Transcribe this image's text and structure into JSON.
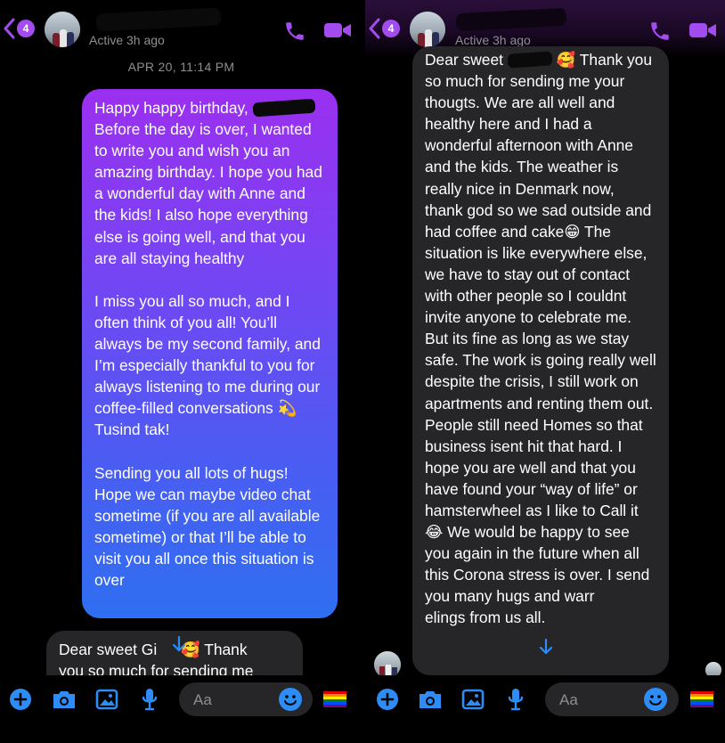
{
  "conversation": {
    "unread_count": "4",
    "status": "Active 3h ago"
  },
  "date_divider": "APR 20, 11:14 PM",
  "sent_message": {
    "para1_before_name": "Happy happy birthday, ",
    "para1_after_name": "\nBefore the day is over, I wanted to write you and wish you an amazing birthday. I hope you had a wonderful day with Anne and the kids! I also hope everything else is going well, and that you are all staying healthy",
    "para2": "I miss you all so much, and I often think of you all! You’ll always be my second family, and I’m especially thankful to you for always listening to me during our coffee-filled conversations 💫 Tusind tak!",
    "para3": "Sending you all lots of hugs! Hope we can maybe video chat sometime (if you are all available sometime) or that I’ll be able to visit you all once this situation is over"
  },
  "received_preview": {
    "line1_before": "Dear sweet Gi",
    "line1_after": " 🥰 Thank",
    "line2": "you so much for sending me"
  },
  "received_message": {
    "greeting_before": "Dear sweet ",
    "greeting_after": " 🥰 Thank",
    "body": "you so much for sending me your thougts. We are all well and healthy here and I had a wonderful afternoon with Anne and the kids. The weather is really nice in Denmark now, thank god so we sad outside and had coffee and cake😁 The situation is like everywhere else, we have to stay out of contact with other people so I couldnt invite anyone to celebrate me. But its fine as long as we stay safe. The work is going really well despite the crisis, I still work on apartments and renting them out. People still need Homes so that business isent hit that hard. I hope you are well and that you have found your “way of life” or hamsterwheel as I like to Call it 😂 We would be happy to see you again in the future when all this Corona stress is over. I send you many hugs and warr",
    "body_after_button": "elings from us all."
  },
  "composer": {
    "placeholder": "Aa"
  },
  "colors": {
    "accent": "#a24cf0",
    "icon_blue": "#2d8cf6",
    "bubble_gray": "#262628",
    "header_purple": "#2a0f3a"
  },
  "icons": {
    "back": "chevron-left-icon",
    "call": "phone-icon",
    "video": "video-camera-icon",
    "add": "plus-circle-icon",
    "camera": "camera-icon",
    "gallery": "image-icon",
    "voice": "microphone-icon",
    "emoji": "smiley-icon",
    "sticker": "rainbow-flag-icon",
    "scroll": "arrow-down-icon"
  }
}
